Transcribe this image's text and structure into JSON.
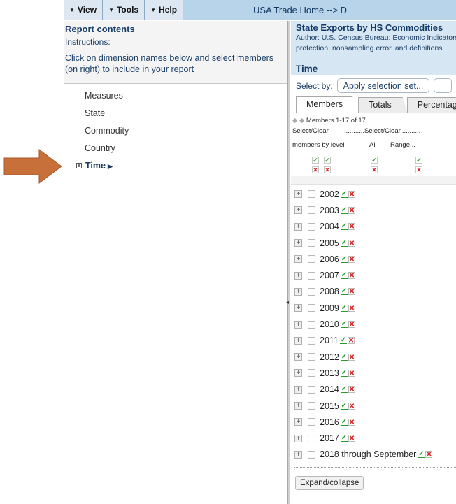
{
  "menubar": {
    "items": [
      {
        "label": "View"
      },
      {
        "label": "Tools"
      },
      {
        "label": "Help"
      }
    ],
    "breadcrumb": "USA Trade Home --> D"
  },
  "left": {
    "title": "Report contents",
    "instructions_label": "Instructions:",
    "instructions_text": "Click on dimension names below and select members (on right) to include in your report",
    "dimensions": [
      "Measures",
      "State",
      "Commodity",
      "Country",
      "Time"
    ]
  },
  "right": {
    "title": "State Exports by HS Commodities",
    "author_line1": "Author: U.S. Census Bureau: Economic Indicators",
    "author_line2": "protection, nonsampling error, and definitions",
    "section": "Time",
    "select_by_label": "Select by:",
    "apply_button": "Apply selection set...",
    "tabs": [
      "Members",
      "Totals",
      "Percentages"
    ],
    "members_range": "Members 1-17 of 17",
    "select_clear": "Select/Clear",
    "select_clear_dotted": "...........Select/Clear...........",
    "members_by_level": "members by level",
    "all_label": "All",
    "range_label": "Range...",
    "years": [
      "2002",
      "2003",
      "2004",
      "2005",
      "2006",
      "2007",
      "2008",
      "2009",
      "2010",
      "2011",
      "2012",
      "2013",
      "2014",
      "2015",
      "2016",
      "2017",
      "2018 through September"
    ],
    "expand_button": "Expand/collapse"
  },
  "colors": {
    "menubar_bg": "#b8d4ea",
    "title_blue": "#1a3e67",
    "check_green": "#2a9a2a",
    "cross_red": "#d22222",
    "pointer_arrow": "#c8703a"
  }
}
